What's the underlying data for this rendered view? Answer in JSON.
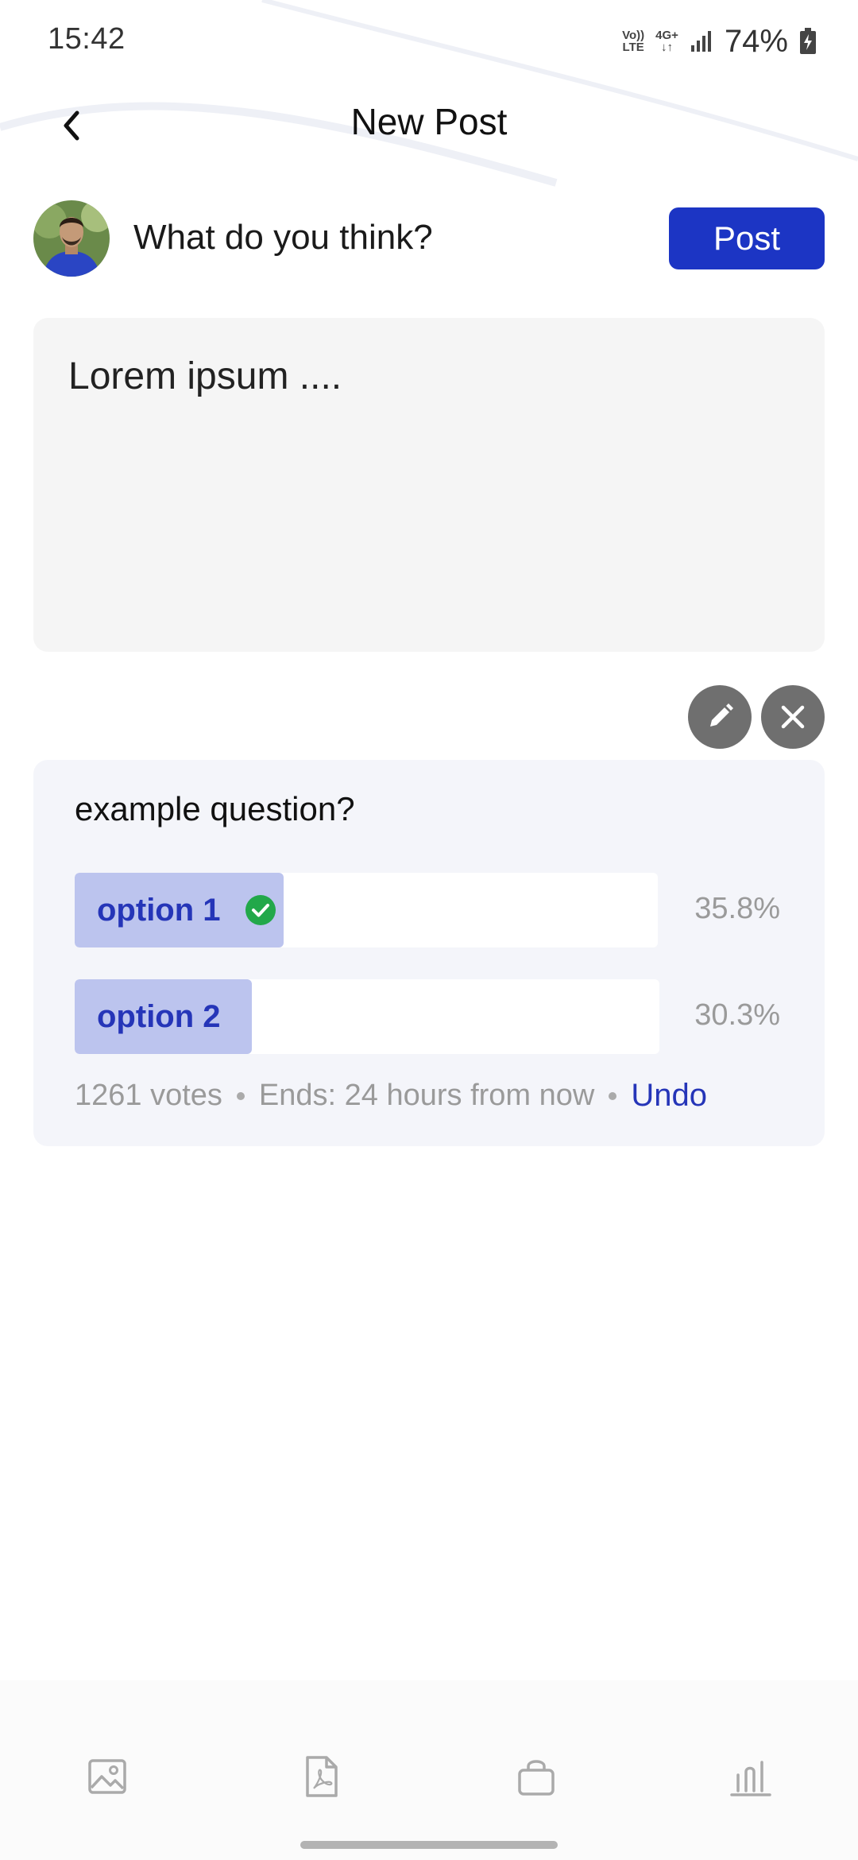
{
  "status_bar": {
    "time": "15:42",
    "volte_top": "Vo))",
    "volte_bottom": "LTE",
    "network_top": "4G+",
    "network_bottom": "↓↑",
    "battery": "74%"
  },
  "header": {
    "title": "New Post",
    "back_icon": "chevron-left-icon"
  },
  "composer": {
    "prompt": "What do you think?",
    "post_label": "Post",
    "text": "Lorem ipsum ...."
  },
  "poll": {
    "question": "example question?",
    "options": [
      {
        "label": "option 1",
        "percent": "35.8%",
        "fill_fraction": 0.358,
        "selected": true
      },
      {
        "label": "option 2",
        "percent": "30.3%",
        "fill_fraction": 0.303,
        "selected": false
      }
    ],
    "votes": "1261 votes",
    "ends": "Ends: 24 hours from now",
    "undo_label": "Undo"
  },
  "toolbar": {
    "items": [
      "image-icon",
      "pdf-icon",
      "shopping-bag-icon",
      "poll-chart-icon"
    ]
  },
  "colors": {
    "accent": "#1c35c4",
    "poll_fill": "#bcc4ee",
    "check_green": "#22a84a"
  }
}
